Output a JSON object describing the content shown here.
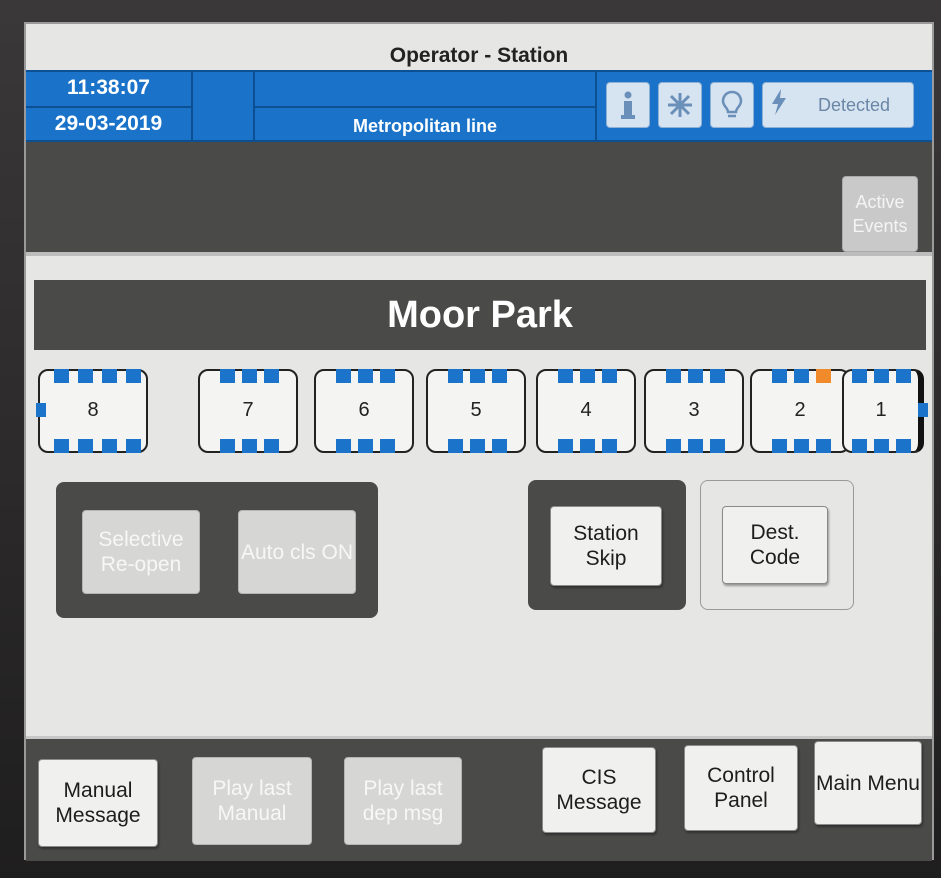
{
  "window": {
    "title": "Operator - Station"
  },
  "header": {
    "time": "11:38:07",
    "date": "29-03-2019",
    "line_name": "Metropolitan line",
    "status_label": "Detected",
    "icons": [
      "info-icon",
      "snowflake-icon",
      "lightbulb-icon",
      "lightning-icon"
    ]
  },
  "events": {
    "active_events_label": "Active Events"
  },
  "station": {
    "name": "Moor Park"
  },
  "cars": [
    {
      "number": "8"
    },
    {
      "number": "7"
    },
    {
      "number": "6"
    },
    {
      "number": "5"
    },
    {
      "number": "4"
    },
    {
      "number": "3"
    },
    {
      "number": "2"
    },
    {
      "number": "1"
    }
  ],
  "controls": {
    "selective_reopen": "Selective Re-open",
    "auto_cls": "Auto cls ON",
    "station_skip": "Station Skip",
    "dest_code": "Dest. Code"
  },
  "bottom_bar": {
    "manual_message": "Manual Message",
    "play_last_manual": "Play last Manual",
    "play_last_dep": "Play last dep msg",
    "cis_message": "CIS Message",
    "control_panel": "Control Panel",
    "main_menu": "Main Menu"
  },
  "colors": {
    "header_blue": "#1a73c8",
    "door_blue": "#1b74c9",
    "door_alert": "#f08a2b",
    "panel_dark": "#4a4a49"
  }
}
